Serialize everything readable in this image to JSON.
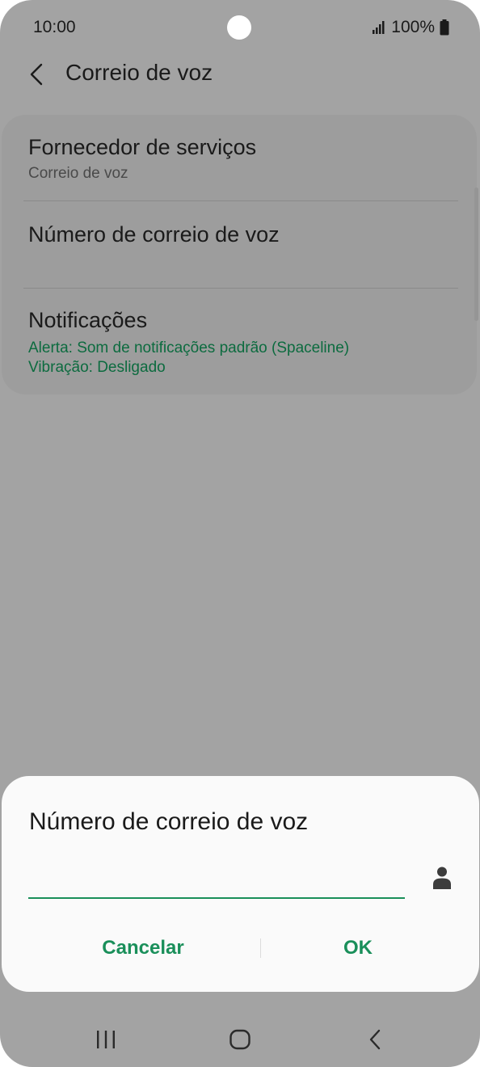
{
  "status_bar": {
    "time": "10:00",
    "battery": "100%",
    "icons": [
      "signal-icon",
      "battery-icon"
    ]
  },
  "app_bar": {
    "title": "Correio de voz",
    "back_icon": "chevron-left-icon"
  },
  "settings": {
    "items": [
      {
        "title": "Fornecedor de serviços",
        "subtitles": [
          "Correio de voz"
        ]
      },
      {
        "title": "Número de correio de voz",
        "subtitles": []
      },
      {
        "title": "Notificações",
        "subtitles": [
          "Alerta: Som de notificações padrão (Spaceline)",
          "Vibração: Desligado"
        ]
      }
    ]
  },
  "dialog": {
    "title": "Número de correio de voz",
    "input_value": "",
    "contact_icon": "person-icon",
    "cancel_label": "Cancelar",
    "ok_label": "OK"
  },
  "nav_bar": {
    "icons": [
      "recents-icon",
      "home-icon",
      "back-icon"
    ]
  },
  "colors": {
    "accent_green": "#1a8f5a",
    "subtitle_green": "#0c6b3f",
    "scrim_background": "#a3a3a3",
    "dialog_background": "#fafafa"
  }
}
